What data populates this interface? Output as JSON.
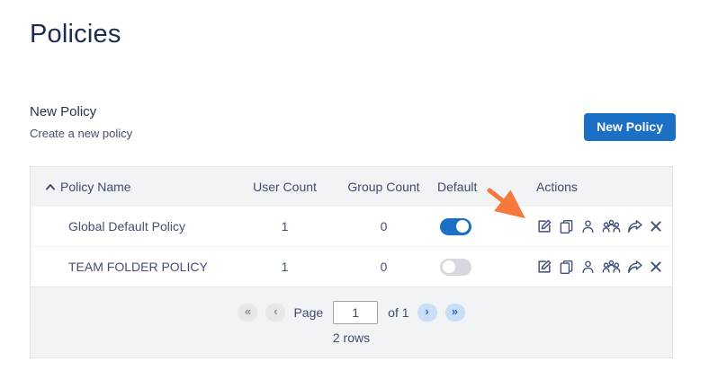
{
  "page": {
    "title": "Policies",
    "section": {
      "heading": "New Policy",
      "subheading": "Create a new policy"
    },
    "new_policy_button": "New Policy"
  },
  "table": {
    "columns": [
      "Policy Name",
      "User Count",
      "Group Count",
      "Default",
      "Actions"
    ],
    "sort": {
      "column": "Policy Name",
      "direction": "ascending",
      "icon": "chevron-up-icon"
    },
    "rows": [
      {
        "policy_name": "Global Default Policy",
        "user_count": "1",
        "group_count": "0",
        "default_on": true
      },
      {
        "policy_name": "TEAM FOLDER POLICY",
        "user_count": "1",
        "group_count": "0",
        "default_on": false
      }
    ],
    "action_icons": [
      "edit-icon",
      "copy-icon",
      "assign-user-icon",
      "assign-group-icon",
      "share-icon",
      "delete-x-icon"
    ],
    "pagination": {
      "first_label": "«",
      "prev_label": "‹",
      "page_label": "Page",
      "current_page": "1",
      "of_label": "of 1",
      "next_label": "›",
      "last_label": "»",
      "rows_summary": "2 rows"
    }
  },
  "annotation": {
    "type": "orange-arrow",
    "points_to": "edit-icon-row-1",
    "color": "#f5793b"
  },
  "colors": {
    "accent_blue": "#1b6fc4",
    "title_navy": "#1d2d50",
    "table_text": "#425072",
    "header_bg": "#f2f3f5",
    "toggle_off": "#d8d8dc",
    "pager_active_bg": "#c9ddf6",
    "pager_disabled_bg": "#e7e7ea",
    "arrow_orange": "#f5793b"
  }
}
